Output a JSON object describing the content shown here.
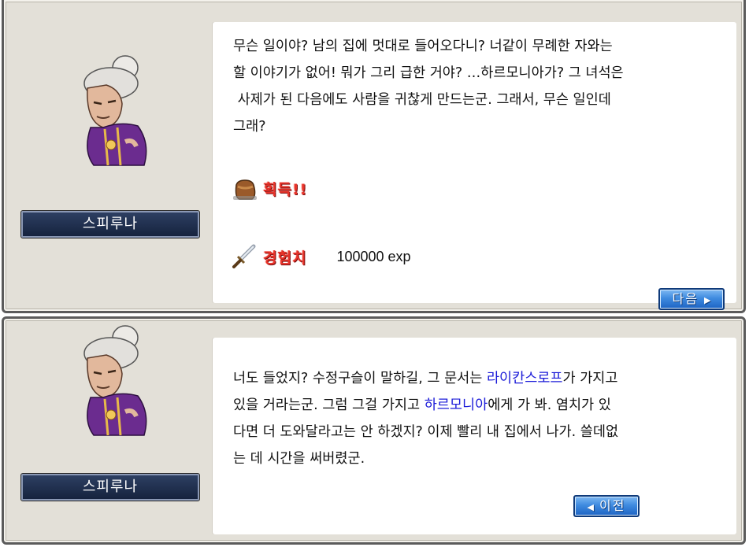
{
  "dialogs": [
    {
      "npc_name": "스피루나",
      "text": "무슨 일이야? 남의 집에 멋대로 들어오다니? 너같이 무례한 자와는\n할 이야기가 없어! 뭐가 그리 급한 거야? …하르모니아가? 그 녀석은\n 사제가 된 다음에도 사람을 귀찮게 만드는군. 그래서, 무슨 일인데\n그래?",
      "reward_obtain_label": "획득!!",
      "reward_exp_label": "경험치",
      "reward_exp_value": "100000 exp",
      "next_label": "다음"
    },
    {
      "npc_name": "스피루나",
      "text_parts": {
        "a": "너도 들었지? 수정구슬이 말하길, 그 문서는 ",
        "b": "라이칸스로프",
        "c": "가 가지고\n있을 거라는군. 그럼 그걸 가지고 ",
        "d": "하르모니아",
        "e": "에게 가 봐. 염치가 있\n다면 더 도와달라고는 안 하겠지? 이제 빨리 내 집에서 나가. 쓸데없\n는 데 시간을 써버렸군."
      },
      "prev_label": "이전"
    }
  ],
  "colors": {
    "highlight": "#1b1bd8",
    "reward_red": "#e8332a",
    "button_blue": "#3f8be0",
    "nameplate_navy": "#1f2e4d"
  },
  "icons": {
    "npc_portrait": "old-woman-portrait",
    "obtain": "brown-bag-icon",
    "exp": "sword-icon",
    "next_arrow": "triangle-right-icon",
    "prev_arrow": "triangle-left-icon"
  }
}
